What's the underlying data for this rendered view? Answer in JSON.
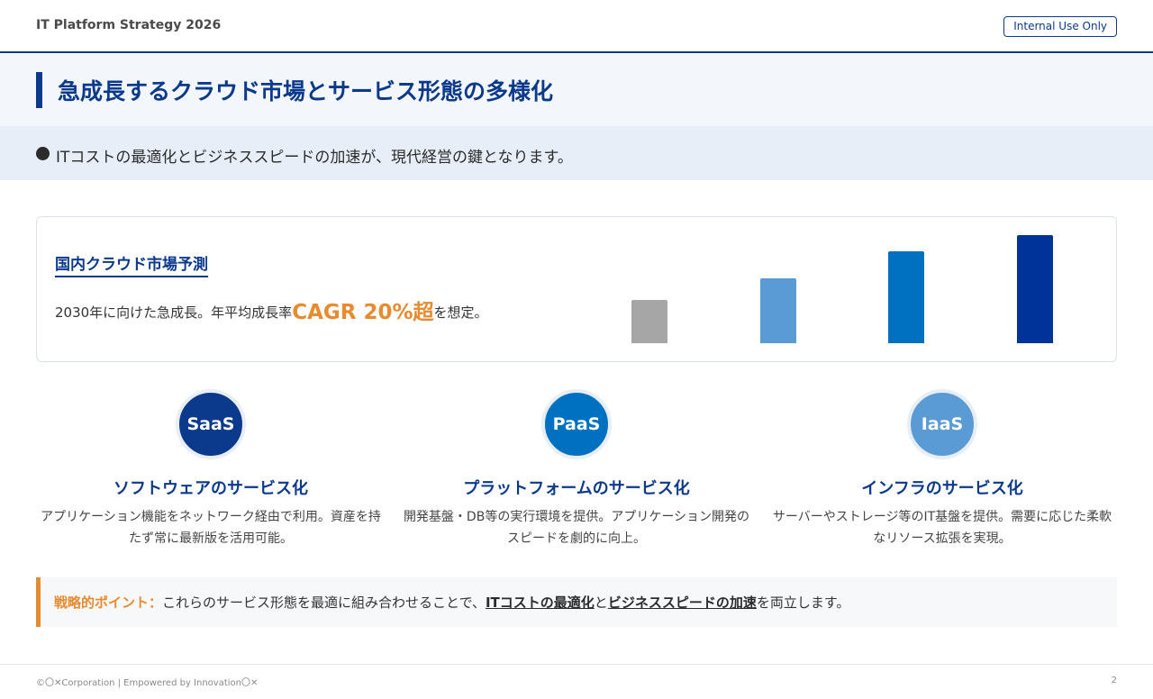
{
  "header": {
    "deck_title": "IT Platform Strategy 2026",
    "badge": "Internal Use Only"
  },
  "title": "急成長するクラウド市場とサービス形態の多様化",
  "lead": "ITコストの最適化とビジネススピードの加速が、現代経営の鍵となります。",
  "market": {
    "title": "国内クラウド市場予測",
    "text_before": "2030年に向けた急成長。年平均成長率",
    "text_emphasis": "CAGR 20%超",
    "text_after": "を想定。"
  },
  "chart_data": {
    "type": "bar",
    "categories": [],
    "values": [
      0.4,
      0.6,
      0.85,
      1.0
    ],
    "colors": [
      "#a6a6a6",
      "#5b9bd5",
      "#0070c0",
      "#003399"
    ]
  },
  "services": [
    {
      "badge": "SaaS",
      "color": "#0b3a8c",
      "title": "ソフトウェアのサービス化",
      "desc": "アプリケーション機能をネットワーク経由で利用。資産を持たず常に最新版を活用可能。"
    },
    {
      "badge": "PaaS",
      "color": "#0070c0",
      "title": "プラットフォームのサービス化",
      "desc": "開発基盤・DB等の実行環境を提供。アプリケーション開発のスピードを劇的に向上。"
    },
    {
      "badge": "IaaS",
      "color": "#5b9bd5",
      "title": "インフラのサービス化",
      "desc": "サーバーやストレージ等のIT基盤を提供。需要に応じた柔軟なリソース拡張を実現。"
    }
  ],
  "point": {
    "label": "戦略的ポイント：",
    "text_1": "これらのサービス形態を最適に組み合わせることで、",
    "strong_1": "ITコストの最適化",
    "text_2": "と",
    "strong_2": "ビジネススピードの加速",
    "text_3": "を両立します。"
  },
  "footer": {
    "text": "©〇✕Corporation | Empowered by Innovation〇✕",
    "page": "2"
  },
  "colors": {
    "primary": "#0b3a8c",
    "accent": "#e88a2e"
  }
}
